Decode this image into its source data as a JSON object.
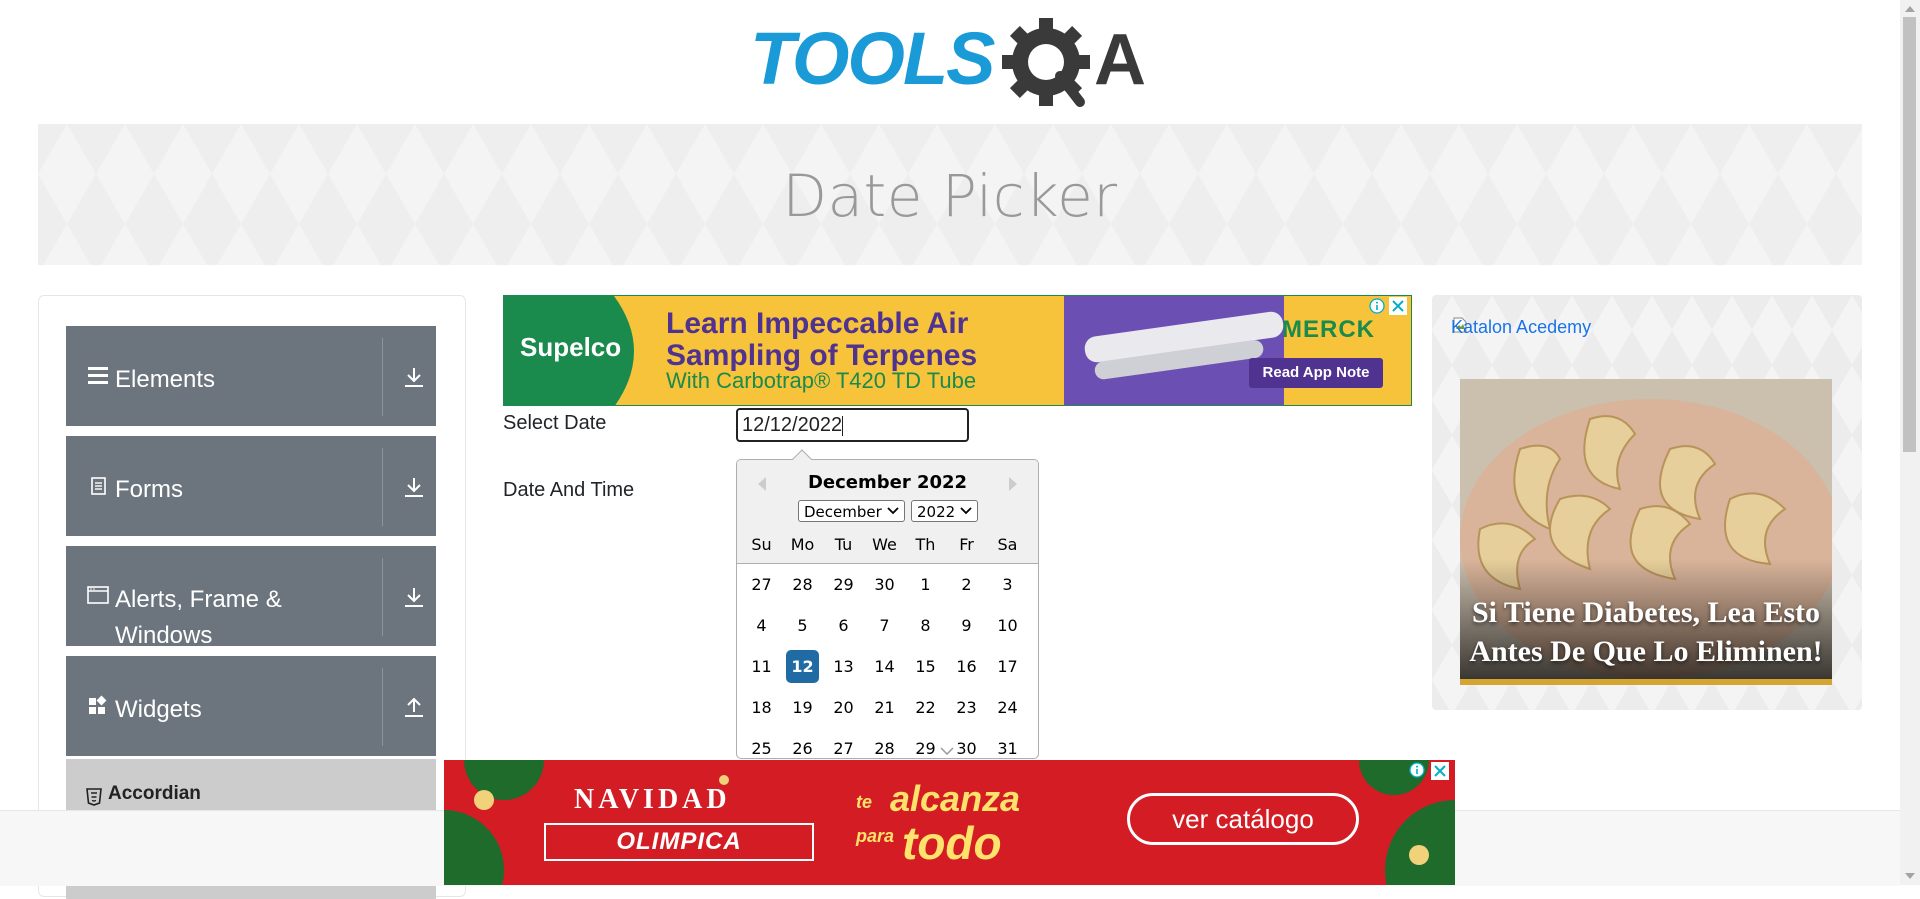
{
  "logo": {
    "text_left": "TOOLS",
    "text_right": "A"
  },
  "banner": {
    "title": "Date Picker"
  },
  "sidebar": {
    "groups": [
      {
        "label": "Elements",
        "icon": "menu-icon",
        "state": "collapsed"
      },
      {
        "label": "Forms",
        "icon": "document-icon",
        "state": "collapsed"
      },
      {
        "label": "Alerts, Frame & Windows",
        "icon": "window-icon",
        "state": "collapsed"
      },
      {
        "label": "Widgets",
        "icon": "widgets-icon",
        "state": "expanded"
      }
    ],
    "active_item": {
      "label": "Accordian",
      "icon": "html5-icon"
    }
  },
  "top_ad": {
    "brand_left": "Supelco",
    "headline": "Learn Impeccable Air Sampling of Terpenes",
    "subline": "With Carbotrap® T420 TD Tube",
    "brand_right": "MERCK",
    "cta": "Read App Note"
  },
  "form": {
    "select_date_label": "Select Date",
    "date_time_label": "Date And Time",
    "date_value": "12/12/2022"
  },
  "datepicker": {
    "title": "December 2022",
    "month_select": "December",
    "year_select": "2022",
    "day_names": [
      "Su",
      "Mo",
      "Tu",
      "We",
      "Th",
      "Fr",
      "Sa"
    ],
    "weeks": [
      [
        "27",
        "28",
        "29",
        "30",
        "1",
        "2",
        "3"
      ],
      [
        "4",
        "5",
        "6",
        "7",
        "8",
        "9",
        "10"
      ],
      [
        "11",
        "12",
        "13",
        "14",
        "15",
        "16",
        "17"
      ],
      [
        "18",
        "19",
        "20",
        "21",
        "22",
        "23",
        "24"
      ],
      [
        "25",
        "26",
        "27",
        "28",
        "29",
        "30",
        "31"
      ]
    ],
    "selected_day": "12",
    "accent_color": "#216ba5"
  },
  "right_ad": {
    "link_text": "Katalon Acedemy",
    "caption": "Si Tiene Diabetes, Lea Esto Antes De Que Lo Eliminen!"
  },
  "bottom_ad": {
    "headline": "NAVIDAD",
    "brand": "OLIMPICA",
    "te": "te",
    "alcanza": "alcanza",
    "para": "para",
    "todo": "todo",
    "cta": "ver catálogo"
  },
  "colors": {
    "sidebar_group_bg": "#6c757d",
    "sidebar_active_bg": "#cccccc",
    "logo_blue": "#1a9ad6",
    "logo_gray": "#3a3a3a"
  }
}
